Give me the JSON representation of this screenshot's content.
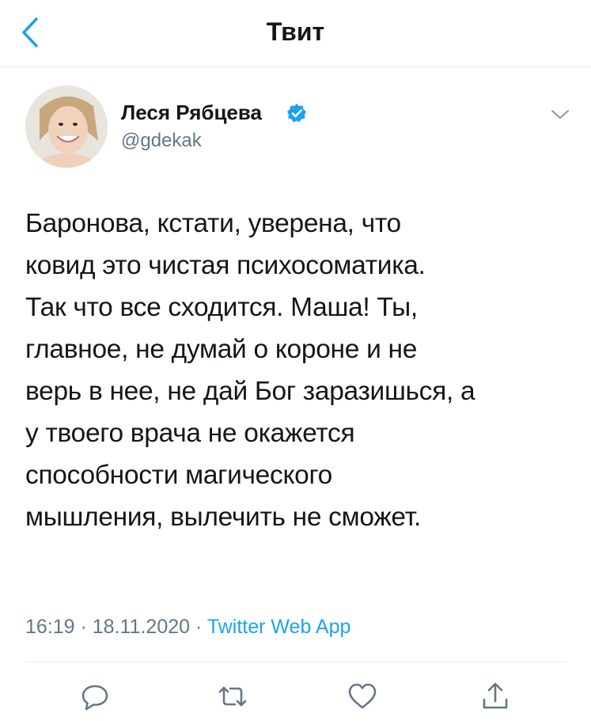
{
  "header": {
    "title": "Твит"
  },
  "tweet": {
    "author_name": "Леся Рябцева",
    "handle": "@gdekak",
    "verified": true,
    "text": "Баронова, кстати, уверена, что\nковид это чистая психосоматика.\nТак что все сходится. Маша! Ты,\nглавное, не думай о короне и не\nверь в нее, не дай Бог заразишься, а\nу твоего врача не окажется\nспособности магического\nмышления, вылечить не сможет.",
    "time": "16:19",
    "separator": " · ",
    "date": "18.11.2020",
    "source": "Twitter Web App"
  },
  "actions": [
    "reply-icon",
    "retweet-icon",
    "like-icon",
    "share-icon"
  ],
  "colors": {
    "accent": "#1da1f2",
    "secondary_text": "#657786",
    "icon": "#657786",
    "divider": "#e6ecf0"
  }
}
